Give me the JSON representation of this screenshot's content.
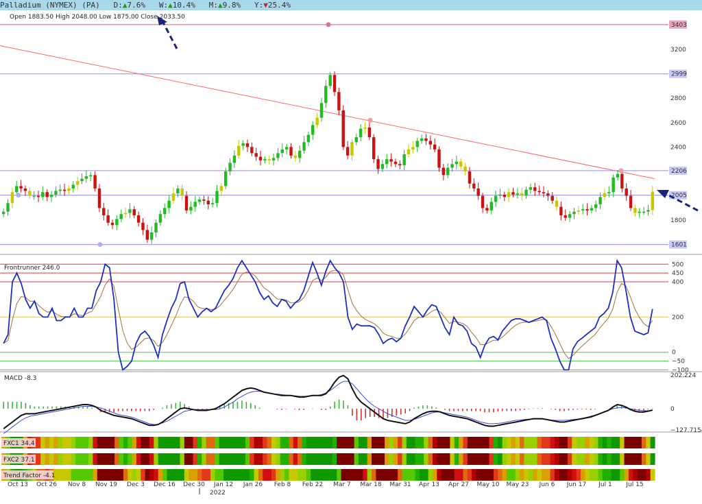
{
  "header": {
    "title": "Palladium (NYMEX) (PA)",
    "d_label": "D:",
    "d_arrow": "▲",
    "d_value": "7.6%",
    "w_label": "W:",
    "w_arrow": "▲",
    "w_value": "10.4%",
    "m_label": "M:",
    "m_arrow": "▲",
    "m_value": "9.8%",
    "y_label": "Y:",
    "y_arrow": "▼",
    "y_value": "25.4%",
    "ohlc": "Open 1883.50  High 2048.00  Low 1875.00  Close 2033.50"
  },
  "colors": {
    "up": "#22bb22",
    "down": "#cc1111",
    "neutral": "#c8c800",
    "topbar": "#a9d8ea",
    "trend": "#ff5555",
    "blue": "#1a2ec0"
  },
  "chart_data": [
    {
      "type": "candlestick",
      "title": "Palladium (NYMEX) (PA)",
      "x_ticks": [
        "Oct 13",
        "Oct 26",
        "Nov 8",
        "Nov 19",
        "Dec 3",
        "Dec 16",
        "Dec 30",
        "Jan 12",
        "Jan 26",
        "Feb 8",
        "Feb 22",
        "Mar 7",
        "Mar 18",
        "Mar 31",
        "Apr 13",
        "Apr 27",
        "May 10",
        "May 23",
        "Jun 6",
        "Jun 17",
        "Jul 1",
        "Jul 15"
      ],
      "x_year_label": "2022",
      "y_ticks": [
        1800,
        2000,
        2200,
        2400,
        2600,
        2800,
        3000,
        3200,
        3400
      ],
      "y_range": [
        1520,
        3520
      ],
      "horizontal_levels": [
        {
          "value": 3403,
          "label": "3403",
          "color": "#c03060"
        },
        {
          "value": 2999,
          "label": "2999",
          "color": "#7070e8"
        },
        {
          "value": 2206,
          "label": "2206",
          "color": "#7070e8"
        },
        {
          "value": 2005,
          "label": "2005",
          "color": "#7070e8"
        },
        {
          "value": 1601,
          "label": "1601",
          "color": "#7070e8"
        }
      ],
      "series": [
        {
          "name": "close",
          "values": [
            1870,
            1940,
            2030,
            2080,
            2060,
            2040,
            2000,
            2000,
            1990,
            2030,
            1990,
            2010,
            2040,
            2050,
            2040,
            2060,
            2090,
            2120,
            2140,
            2160,
            2170,
            2060,
            1900,
            1840,
            1780,
            1760,
            1810,
            1850,
            1860,
            1890,
            1840,
            1780,
            1720,
            1640,
            1700,
            1780,
            1850,
            1900,
            1960,
            2020,
            2060,
            2000,
            1880,
            1910,
            1950,
            1970,
            1960,
            1930,
            1940,
            2040,
            2080,
            2200,
            2270,
            2330,
            2410,
            2430,
            2400,
            2350,
            2320,
            2290,
            2300,
            2290,
            2310,
            2350,
            2380,
            2400,
            2330,
            2310,
            2370,
            2440,
            2500,
            2580,
            2640,
            2760,
            2900,
            2990,
            2850,
            2700,
            2400,
            2330,
            2440,
            2480,
            2550,
            2560,
            2480,
            2300,
            2220,
            2260,
            2300,
            2280,
            2260,
            2250,
            2340,
            2380,
            2400,
            2450,
            2470,
            2450,
            2420,
            2380,
            2230,
            2170,
            2230,
            2260,
            2280,
            2240,
            2200,
            2100,
            2060,
            2000,
            1900,
            1880,
            1950,
            2000,
            2010,
            1990,
            2030,
            2010,
            2020,
            2000,
            2050,
            2070,
            2040,
            2030,
            2020,
            2000,
            1960,
            1910,
            1840,
            1820,
            1850,
            1870,
            1880,
            1890,
            1880,
            1900,
            1930,
            1990,
            2020,
            2030,
            2150,
            2180,
            2060,
            2000,
            1900,
            1860,
            1870,
            1870,
            1883,
            2033
          ]
        }
      ]
    },
    {
      "type": "line",
      "title": "Frontrunner 246.0",
      "levels": [
        500,
        450,
        400,
        200,
        0,
        -50,
        -100
      ],
      "y_range": [
        -110,
        540
      ],
      "series": [
        {
          "name": "Frontrunner",
          "values": [
            50,
            100,
            400,
            450,
            390,
            300,
            250,
            290,
            220,
            200,
            200,
            250,
            180,
            180,
            200,
            200,
            250,
            200,
            200,
            250,
            250,
            350,
            400,
            500,
            480,
            300,
            0,
            -100,
            -80,
            -50,
            50,
            100,
            120,
            90,
            40,
            -30,
            100,
            180,
            250,
            300,
            390,
            400,
            300,
            250,
            200,
            230,
            250,
            230,
            250,
            300,
            350,
            380,
            420,
            480,
            520,
            480,
            440,
            400,
            340,
            300,
            320,
            280,
            260,
            300,
            290,
            250,
            280,
            300,
            350,
            430,
            510,
            450,
            380,
            460,
            520,
            480,
            450,
            400,
            200,
            130,
            160,
            150,
            150,
            150,
            140,
            100,
            50,
            70,
            80,
            60,
            80,
            150,
            200,
            260,
            230,
            200,
            240,
            270,
            260,
            200,
            140,
            100,
            200,
            160,
            150,
            120,
            50,
            30,
            -30,
            40,
            80,
            90,
            70,
            120,
            150,
            180,
            190,
            190,
            180,
            170,
            180,
            190,
            200,
            180,
            80,
            20,
            -50,
            -100,
            -100,
            20,
            60,
            80,
            100,
            120,
            140,
            200,
            220,
            250,
            340,
            520,
            480,
            350,
            200,
            120,
            110,
            100,
            110,
            246
          ]
        }
      ]
    },
    {
      "type": "line",
      "title": "MACD -8.3",
      "y_ticks": [
        202.224,
        0,
        -127.7154
      ],
      "y_range": [
        -140,
        215
      ],
      "series": [
        {
          "name": "MACD",
          "values": [
            -120,
            -100,
            -80,
            -60,
            -40,
            -30,
            -30,
            -30,
            -25,
            -20,
            -15,
            -10,
            -5,
            0,
            5,
            10,
            15,
            20,
            25,
            25,
            20,
            10,
            -10,
            -20,
            -30,
            -40,
            -45,
            -50,
            -55,
            -60,
            -70,
            -80,
            -90,
            -100,
            -100,
            -95,
            -80,
            -60,
            -40,
            -20,
            0,
            5,
            0,
            -5,
            -10,
            -10,
            -10,
            -5,
            0,
            15,
            30,
            50,
            70,
            90,
            110,
            120,
            125,
            120,
            110,
            100,
            95,
            90,
            85,
            80,
            80,
            80,
            75,
            70,
            70,
            75,
            80,
            80,
            80,
            90,
            120,
            160,
            190,
            200,
            180,
            120,
            70,
            40,
            20,
            0,
            -20,
            -40,
            -60,
            -70,
            -75,
            -80,
            -85,
            -90,
            -80,
            -60,
            -45,
            -30,
            -20,
            -15,
            -15,
            -20,
            -30,
            -40,
            -45,
            -50,
            -55,
            -60,
            -70,
            -80,
            -90,
            -100,
            -105,
            -105,
            -100,
            -95,
            -90,
            -85,
            -80,
            -75,
            -70,
            -65,
            -60,
            -60,
            -60,
            -65,
            -70,
            -75,
            -80,
            -80,
            -75,
            -70,
            -65,
            -60,
            -55,
            -50,
            -40,
            -30,
            -20,
            -10,
            10,
            25,
            20,
            10,
            -5,
            -15,
            -20,
            -20,
            -15,
            -8
          ]
        },
        {
          "name": "Signal",
          "values": [
            -150,
            -130,
            -110,
            -90,
            -70,
            -55,
            -45,
            -40,
            -35,
            -30,
            -25,
            -20,
            -15,
            -10,
            -5,
            0,
            5,
            10,
            15,
            15,
            15,
            10,
            5,
            -5,
            -15,
            -25,
            -35,
            -40,
            -45,
            -50,
            -60,
            -70,
            -80,
            -90,
            -95,
            -95,
            -85,
            -75,
            -60,
            -45,
            -30,
            -15,
            -10,
            -5,
            -5,
            -5,
            -5,
            -5,
            -5,
            0,
            10,
            25,
            40,
            60,
            75,
            90,
            100,
            105,
            105,
            100,
            95,
            90,
            88,
            85,
            82,
            80,
            78,
            76,
            75,
            75,
            78,
            80,
            85,
            95,
            110,
            130,
            150,
            165,
            165,
            150,
            120,
            90,
            60,
            35,
            15,
            0,
            -15,
            -30,
            -40,
            -50,
            -60,
            -70,
            -70,
            -65,
            -55,
            -45,
            -35,
            -25,
            -20,
            -20,
            -25,
            -30,
            -35,
            -40,
            -45,
            -50,
            -60,
            -70,
            -80,
            -85,
            -90,
            -90,
            -88,
            -85,
            -80,
            -75,
            -70,
            -68,
            -65,
            -63,
            -62,
            -62,
            -63,
            -65,
            -68,
            -70,
            -70,
            -70,
            -68,
            -65,
            -62,
            -58,
            -52,
            -45,
            -38,
            -30,
            -20,
            -10,
            0,
            5,
            8,
            5,
            0,
            -5,
            -10,
            -12,
            -12,
            -10
          ]
        }
      ]
    },
    {
      "type": "heatmap",
      "title": "FXC1 34.4"
    },
    {
      "type": "heatmap",
      "title": "FXC2 37.1"
    },
    {
      "type": "heatmap",
      "title": "Trend Factor -4.1"
    }
  ]
}
